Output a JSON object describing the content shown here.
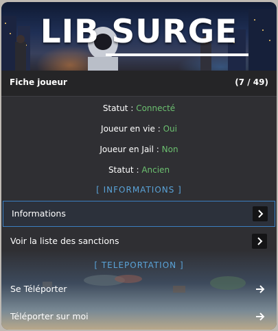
{
  "banner": {
    "title": "LIB SURGE"
  },
  "header": {
    "title": "Fiche joueur",
    "count": "(7 / 49)"
  },
  "info": [
    {
      "label": "Statut : ",
      "value": "Connecté"
    },
    {
      "label": "Joueur en vie : ",
      "value": "Oui"
    },
    {
      "label": "Joueur en Jail : ",
      "value": "Non"
    },
    {
      "label": "Statut : ",
      "value": "Ancien"
    }
  ],
  "sections": {
    "informations": "[ INFORMATIONS ]",
    "teleportation": "[ TELEPORTATION ]"
  },
  "items": [
    {
      "label": "Informations",
      "icon": "chevron-right-icon",
      "selected": true
    },
    {
      "label": "Voir la liste des sanctions",
      "icon": "chevron-right-icon",
      "selected": false
    },
    {
      "label": "Se Téléporter",
      "icon": "arrow-right-icon",
      "selected": false
    },
    {
      "label": "Téléporter sur moi",
      "icon": "arrow-right-icon",
      "selected": false
    }
  ],
  "colors": {
    "accent": "#5aa3d8",
    "status_value": "#6cc070",
    "selection_border": "#3b7fc2"
  }
}
